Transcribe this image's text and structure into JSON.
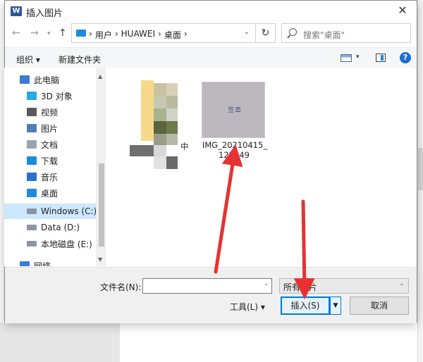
{
  "window": {
    "title": "插入图片",
    "app_icon_letter": "W"
  },
  "nav": {
    "path": [
      "用户",
      "HUAWEI",
      "桌面"
    ],
    "separator": "›"
  },
  "search": {
    "placeholder": "搜索\"桌面\""
  },
  "toolbar": {
    "organize": "组织 ▾",
    "new_folder": "新建文件夹"
  },
  "sidebar": {
    "items": [
      {
        "label": "此电脑",
        "icon": "computer-icon",
        "color": "#3a7bd5"
      },
      {
        "label": "3D 对象",
        "icon": "cube-icon",
        "color": "#29a9e0"
      },
      {
        "label": "视频",
        "icon": "video-icon",
        "color": "#5a5a5a"
      },
      {
        "label": "图片",
        "icon": "pictures-icon",
        "color": "#4f7fb5"
      },
      {
        "label": "文档",
        "icon": "document-icon",
        "color": "#9aa4b0"
      },
      {
        "label": "下载",
        "icon": "download-icon",
        "color": "#1c8be0"
      },
      {
        "label": "音乐",
        "icon": "music-icon",
        "color": "#2a6fd0"
      },
      {
        "label": "桌面",
        "icon": "desktop-icon",
        "color": "#1c8be0"
      },
      {
        "label": "Windows (C:)",
        "icon": "drive-icon",
        "color": "#8a96a4"
      },
      {
        "label": "Data (D:)",
        "icon": "drive-icon",
        "color": "#8a96a4"
      },
      {
        "label": "本地磁盘 (E:)",
        "icon": "drive-icon",
        "color": "#8a96a4"
      },
      {
        "label": "网络",
        "icon": "network-icon",
        "color": "#3a7bd5"
      }
    ]
  },
  "files": [
    {
      "label": "中",
      "type": "folder"
    },
    {
      "label_line1": "IMG_20210415_",
      "label_line2": "123449",
      "type": "image",
      "ink": "签章"
    }
  ],
  "bottom": {
    "filename_label": "文件名(N):",
    "filename_value": "",
    "filetype_value": "所有图片",
    "tools_label": "工具(L)  ▾",
    "insert_label": "插入(S)",
    "cancel_label": "取消"
  },
  "colors": {
    "accent": "#0078d7",
    "arrow": "#e53333",
    "selection": "#cce8ff"
  }
}
